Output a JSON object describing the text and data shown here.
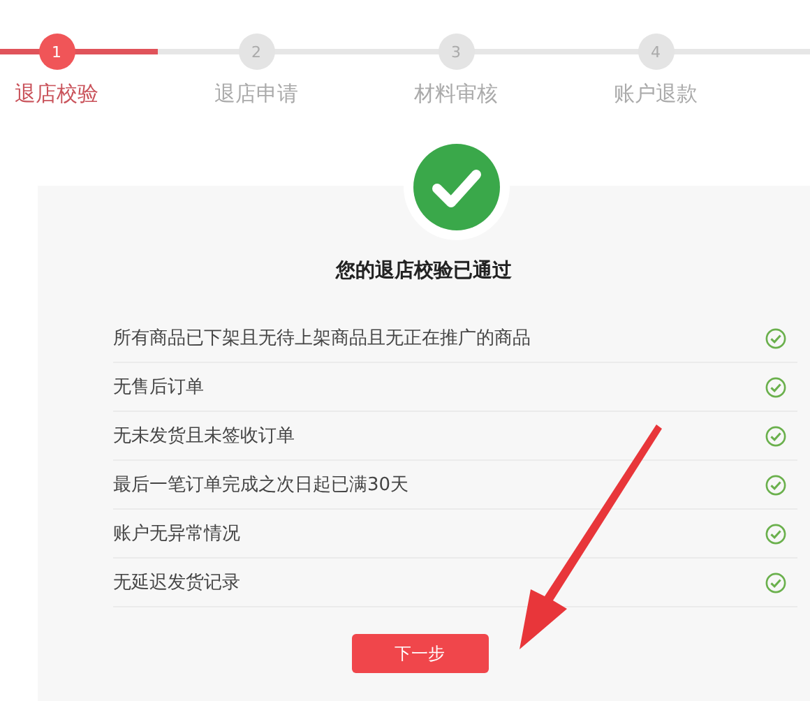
{
  "steps": [
    {
      "number": "1",
      "label": "退店校验",
      "selected": true
    },
    {
      "number": "2",
      "label": "退店申请",
      "selected": false
    },
    {
      "number": "3",
      "label": "材料审核",
      "selected": false
    },
    {
      "number": "4",
      "label": "账户退款",
      "selected": false
    }
  ],
  "result": {
    "title": "您的退店校验已通过",
    "checks": [
      {
        "text": "所有商品已下架且无待上架商品且无正在推广的商品",
        "checked": true
      },
      {
        "text": "无售后订单",
        "checked": true
      },
      {
        "text": "无未发货且未签收订单",
        "checked": true
      },
      {
        "text": "最后一笔订单完成之次日起已满30天",
        "checked": true
      },
      {
        "text": "账户无异常情况",
        "checked": true
      },
      {
        "text": "无延迟发货记录",
        "checked": true
      }
    ],
    "button": "下一步"
  }
}
